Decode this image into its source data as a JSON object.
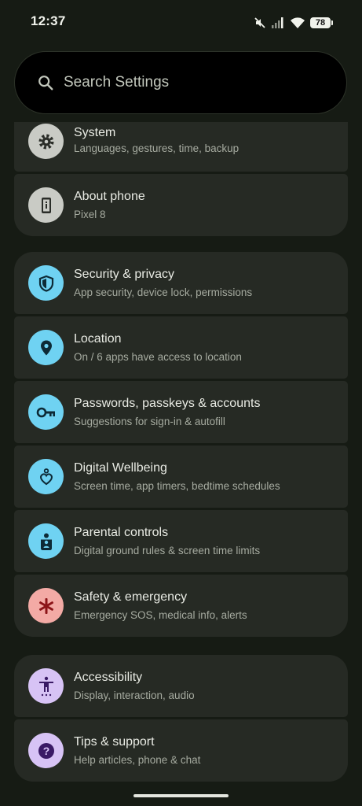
{
  "status": {
    "time": "12:37",
    "battery": "78",
    "icons": [
      "mute-icon",
      "signal-icon",
      "wifi-icon",
      "battery-icon"
    ]
  },
  "search": {
    "placeholder": "Search Settings"
  },
  "groups": [
    {
      "items": [
        {
          "title": "System",
          "subtitle": "Languages, gestures, time, backup",
          "icon": "gear-icon",
          "color": "#c9cbc5"
        },
        {
          "title": "About phone",
          "subtitle": "Pixel 8",
          "icon": "phone-info-icon",
          "color": "#c9cbc5"
        }
      ]
    },
    {
      "items": [
        {
          "title": "Security & privacy",
          "subtitle": "App security, device lock, permissions",
          "icon": "shield-icon",
          "color": "#6fd2f2"
        },
        {
          "title": "Location",
          "subtitle": "On / 6 apps have access to location",
          "icon": "location-pin-icon",
          "color": "#6fd2f2"
        },
        {
          "title": "Passwords, passkeys & accounts",
          "subtitle": "Suggestions for sign-in & autofill",
          "icon": "key-icon",
          "color": "#6fd2f2"
        },
        {
          "title": "Digital Wellbeing",
          "subtitle": "Screen time, app timers, bedtime schedules",
          "icon": "wellbeing-icon",
          "color": "#6fd2f2"
        },
        {
          "title": "Parental controls",
          "subtitle": "Digital ground rules & screen time limits",
          "icon": "parental-icon",
          "color": "#6fd2f2"
        },
        {
          "title": "Safety & emergency",
          "subtitle": "Emergency SOS, medical info, alerts",
          "icon": "asterisk-icon",
          "color": "#f3aaa5"
        }
      ]
    },
    {
      "items": [
        {
          "title": "Accessibility",
          "subtitle": "Display, interaction, audio",
          "icon": "accessibility-icon",
          "color": "#d7c3f5"
        },
        {
          "title": "Tips & support",
          "subtitle": "Help articles, phone & chat",
          "icon": "help-icon",
          "color": "#d7c3f5"
        }
      ]
    }
  ]
}
